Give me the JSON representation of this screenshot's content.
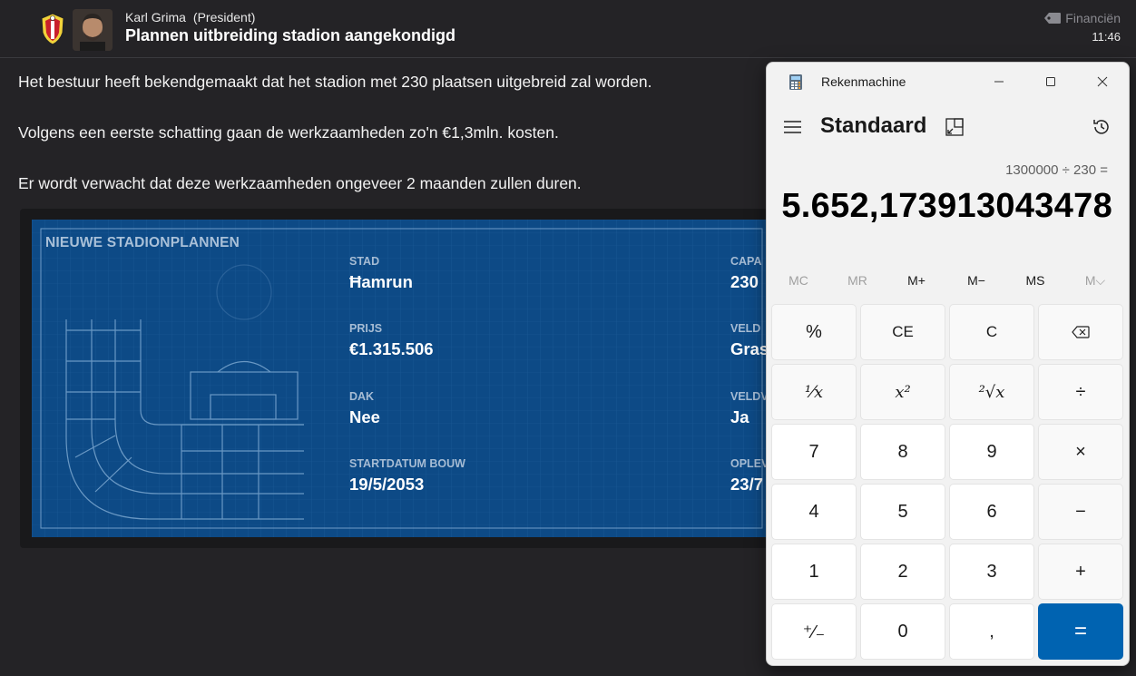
{
  "header": {
    "sender_name": "Karl Grima",
    "sender_role": "(President)",
    "subject": "Plannen uitbreiding stadion aangekondigd",
    "category": "Financiën",
    "time": "11:46"
  },
  "body": {
    "paragraphs": [
      "Het bestuur heeft bekendgemaakt dat het stadion met 230 plaatsen uitgebreid zal worden.",
      "Volgens een eerste schatting gaan de werkzaamheden zo'n €1,3mln. kosten.",
      "Er wordt verwacht dat deze werkzaamheden ongeveer 2 maanden zullen duren."
    ]
  },
  "card": {
    "title": "NIEUWE STADIONPLANNEN",
    "fields": [
      {
        "label": "STAD",
        "value": "Ħamrun"
      },
      {
        "label": "PRIJS",
        "value": "€1.315.506"
      },
      {
        "label": "DAK",
        "value": "Nee"
      },
      {
        "label": "STARTDATUM BOUW",
        "value": "19/5/2053"
      },
      {
        "label": "CAPA",
        "value": "230"
      },
      {
        "label": "VELD",
        "value": "Gras"
      },
      {
        "label": "VELDV",
        "value": "Ja"
      },
      {
        "label": "OPLEV",
        "value": "23/7"
      }
    ]
  },
  "calculator": {
    "app_title": "Rekenmachine",
    "mode": "Standaard",
    "expression": "1300000 ÷ 230 =",
    "result": "5.652,173913043478",
    "memory": [
      "MC",
      "MR",
      "M+",
      "M−",
      "MS",
      "M⌵"
    ],
    "keys": {
      "percent": "%",
      "ce": "CE",
      "c": "C",
      "backspace": "⌫",
      "reciprocal": "¹⁄x",
      "square": "x²",
      "sqrt": "²√x",
      "divide": "÷",
      "seven": "7",
      "eight": "8",
      "nine": "9",
      "multiply": "×",
      "four": "4",
      "five": "5",
      "six": "6",
      "minus": "−",
      "one": "1",
      "two": "2",
      "three": "3",
      "plus": "+",
      "negate": "⁺⁄₋",
      "zero": "0",
      "decimal": ",",
      "equals": "="
    },
    "accent": "#0063b1"
  },
  "colors": {
    "background": "#242326",
    "card_blue": "#0d4a86"
  }
}
